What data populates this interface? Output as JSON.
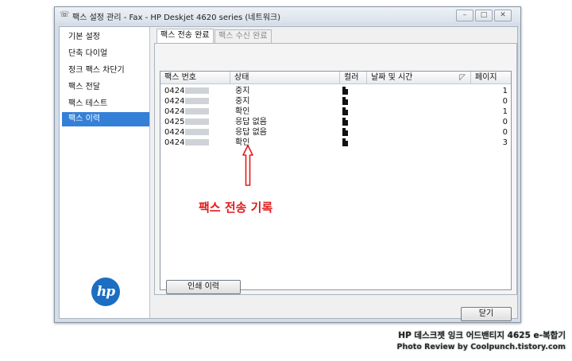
{
  "window": {
    "title": "팩스 설정 관리 - Fax - HP Deskjet 4620 series (네트워크)"
  },
  "titlebar_buttons": [
    "minimize",
    "maximize",
    "close"
  ],
  "sidebar": {
    "items": [
      {
        "label": "기본 설정"
      },
      {
        "label": "단축 다이얼"
      },
      {
        "label": "정크 팩스 차단기"
      },
      {
        "label": "팩스 전달"
      },
      {
        "label": "팩스 테스트"
      },
      {
        "label": "팩스 이력"
      }
    ],
    "selected_index": 5,
    "logo_text": "hp"
  },
  "tabs": [
    {
      "label": "팩스 전송 완료"
    },
    {
      "label": "팩스 수신 완료"
    }
  ],
  "table": {
    "columns": [
      "팩스 번호",
      "상태",
      "컬러",
      "날짜 및 시간",
      "페이지"
    ],
    "rows": [
      {
        "number_prefix": "0424",
        "status": "중지",
        "color_icon": "document-icon",
        "datetime": "",
        "pages": "1"
      },
      {
        "number_prefix": "0424",
        "status": "중지",
        "color_icon": "document-icon",
        "datetime": "",
        "pages": "0"
      },
      {
        "number_prefix": "0424",
        "status": "확인",
        "color_icon": "document-icon",
        "datetime": "",
        "pages": "1"
      },
      {
        "number_prefix": "0425",
        "status": "응답 없음",
        "color_icon": "document-icon",
        "datetime": "",
        "pages": "0"
      },
      {
        "number_prefix": "0424",
        "status": "응답 없음",
        "color_icon": "document-icon",
        "datetime": "",
        "pages": "0"
      },
      {
        "number_prefix": "0424",
        "status": "확인",
        "color_icon": "document-icon",
        "datetime": "",
        "pages": "3"
      }
    ]
  },
  "buttons": {
    "print_history": "인쇄 이력",
    "close": "닫기"
  },
  "annotation": {
    "text": "팩스 전송 기록",
    "color": "#e01b1b"
  },
  "watermark": {
    "line1": "HP 데스크젯 잉크 어드밴티지 4625 e-복합기",
    "line2": "Photo Review by Coolpunch.tistory.com"
  },
  "colors": {
    "selection": "#3380d6",
    "hp_blue": "#1b6ec2"
  }
}
